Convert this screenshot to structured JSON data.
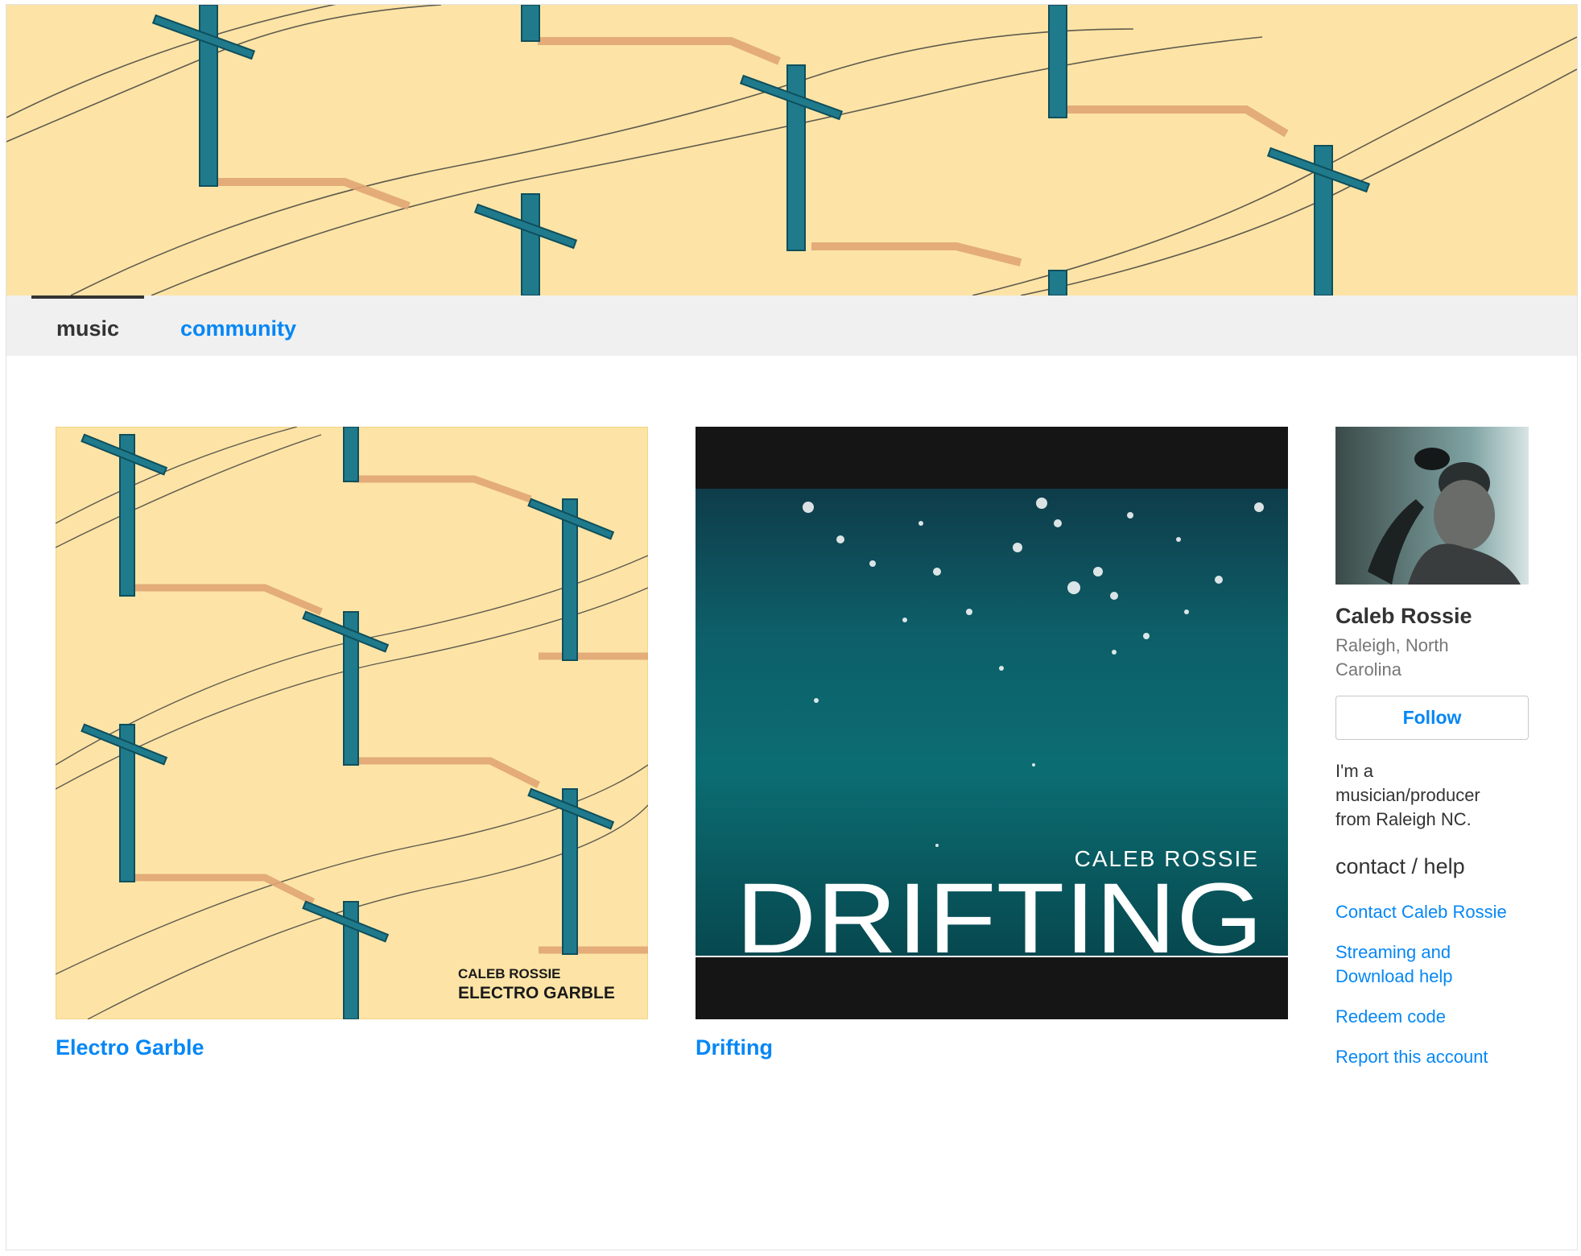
{
  "nav": {
    "tabs": [
      {
        "label": "music",
        "active": true
      },
      {
        "label": "community",
        "active": false
      }
    ]
  },
  "albums": [
    {
      "title": "Electro Garble",
      "cover_artist": "CALEB ROSSIE",
      "cover_title": "ELECTRO GARBLE"
    },
    {
      "title": "Drifting",
      "cover_artist": "CALEB ROSSIE",
      "cover_title": "DRIFTING"
    }
  ],
  "artist": {
    "name": "Caleb Rossie",
    "location": "Raleigh, North Carolina",
    "follow_label": "Follow",
    "bio": "I'm a musician/producer from Raleigh NC."
  },
  "contact": {
    "heading": "contact / help",
    "links": [
      "Contact Caleb Rossie",
      "Streaming and Download help",
      "Redeem code",
      "Report this account"
    ]
  },
  "colors": {
    "link": "#0687f5",
    "banner_bg": "#fde4a6",
    "nav_bg": "#f0f0f0",
    "pole": "#1f7a8c"
  }
}
